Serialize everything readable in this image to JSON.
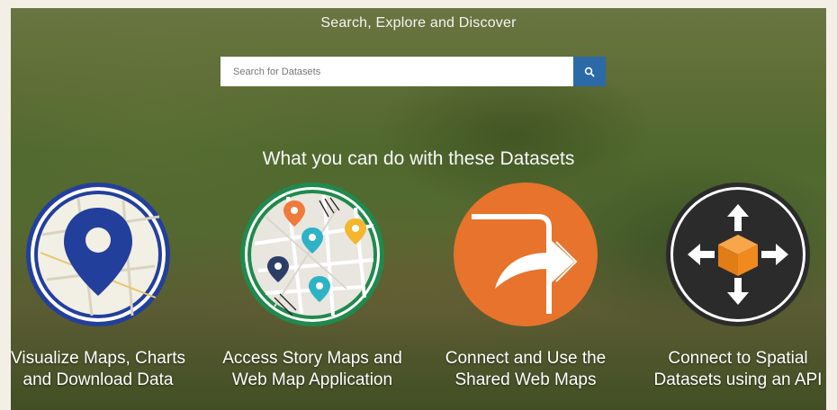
{
  "hero": {
    "title": "Search, Explore and Discover"
  },
  "search": {
    "placeholder": "Search for Datasets",
    "button_icon": "search-icon"
  },
  "section": {
    "title": "What you can do with these Datasets"
  },
  "cards": [
    {
      "label": "Visualize Maps, Charts and Download Data",
      "icon": "map-pin-icon"
    },
    {
      "label": "Access Story Maps and Web Map Application",
      "icon": "street-map-icon"
    },
    {
      "label": "Connect and Use the Shared Web Maps",
      "icon": "share-arrow-icon"
    },
    {
      "label": "Connect to Spatial Datasets using an API",
      "icon": "api-cube-icon"
    }
  ],
  "colors": {
    "search_button": "#2c6aa7",
    "pin_blue": "#233f9c",
    "share_orange": "#e7732c",
    "cube_orange": "#f08a1e",
    "ring_green": "#1f8a4c"
  }
}
